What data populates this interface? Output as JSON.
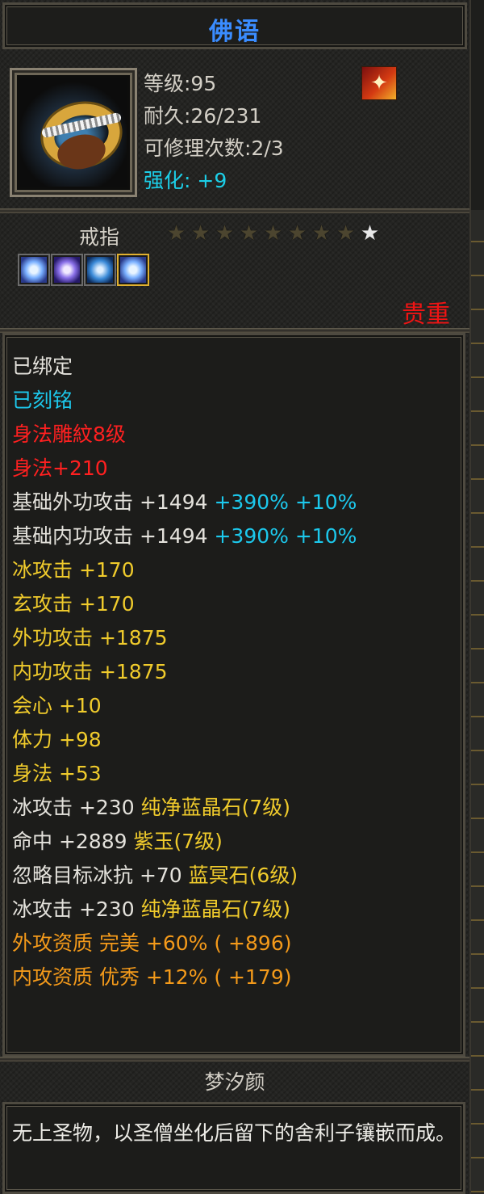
{
  "header": {
    "title": "佛语"
  },
  "item": {
    "icon": "gold-ring-icon",
    "stats": {
      "level": "等级:95",
      "durability": "耐久:26/231",
      "repairs": "可修理次数:2/3",
      "enhance": "强化: +9"
    },
    "badge_icon": "phoenix-badge-icon",
    "type": "戒指",
    "stars": {
      "lit": 1,
      "total": 9
    },
    "gems": [
      "diamond-gem-icon",
      "amethyst-gem-icon",
      "sapphire-gem-icon",
      "diamond-gem-icon"
    ],
    "rarity": "贵重"
  },
  "properties": [
    {
      "text": "已绑定",
      "color": "white"
    },
    {
      "text": "已刻铭",
      "color": "cyan"
    },
    {
      "text": "身法雕紋8级",
      "color": "red"
    },
    {
      "text": "身法+210",
      "color": "red"
    },
    {
      "base": "基础外功攻击 +1494 ",
      "extra": "+390% +10%"
    },
    {
      "base": "基础内功攻击 +1494 ",
      "extra": "+390% +10%"
    },
    {
      "text": "冰攻击 +170",
      "color": "yellow"
    },
    {
      "text": "玄攻击 +170",
      "color": "yellow"
    },
    {
      "text": "外功攻击 +1875",
      "color": "yellow"
    },
    {
      "text": "内功攻击 +1875",
      "color": "yellow"
    },
    {
      "text": "会心 +10",
      "color": "yellow"
    },
    {
      "text": "体力 +98",
      "color": "yellow"
    },
    {
      "text": "身法 +53",
      "color": "yellow"
    },
    {
      "base": "冰攻击 +230 ",
      "extra": "纯净蓝晶石(7级)"
    },
    {
      "base": "命中 +2889 ",
      "extra": "紫玉(7级)"
    },
    {
      "base": "忽略目标冰抗 +70 ",
      "extra": "蓝冥石(6级)"
    },
    {
      "base": "冰攻击 +230 ",
      "extra": "纯净蓝晶石(7级)"
    },
    {
      "text": "外攻资质  完美 +60% ( +896)",
      "color": "orange"
    },
    {
      "text": "内攻资质  优秀 +12% ( +179)",
      "color": "orange"
    }
  ],
  "set_name": "梦汐颜",
  "description": "无上圣物，以圣僧坐化后留下的舍利子镶嵌而成。",
  "colors": {
    "title": "#3a8cff",
    "rarity": "#f01414",
    "cyan": "#1cc8ec",
    "yellow": "#f0cb2c",
    "orange": "#f49a1a",
    "red": "#ff2020"
  }
}
